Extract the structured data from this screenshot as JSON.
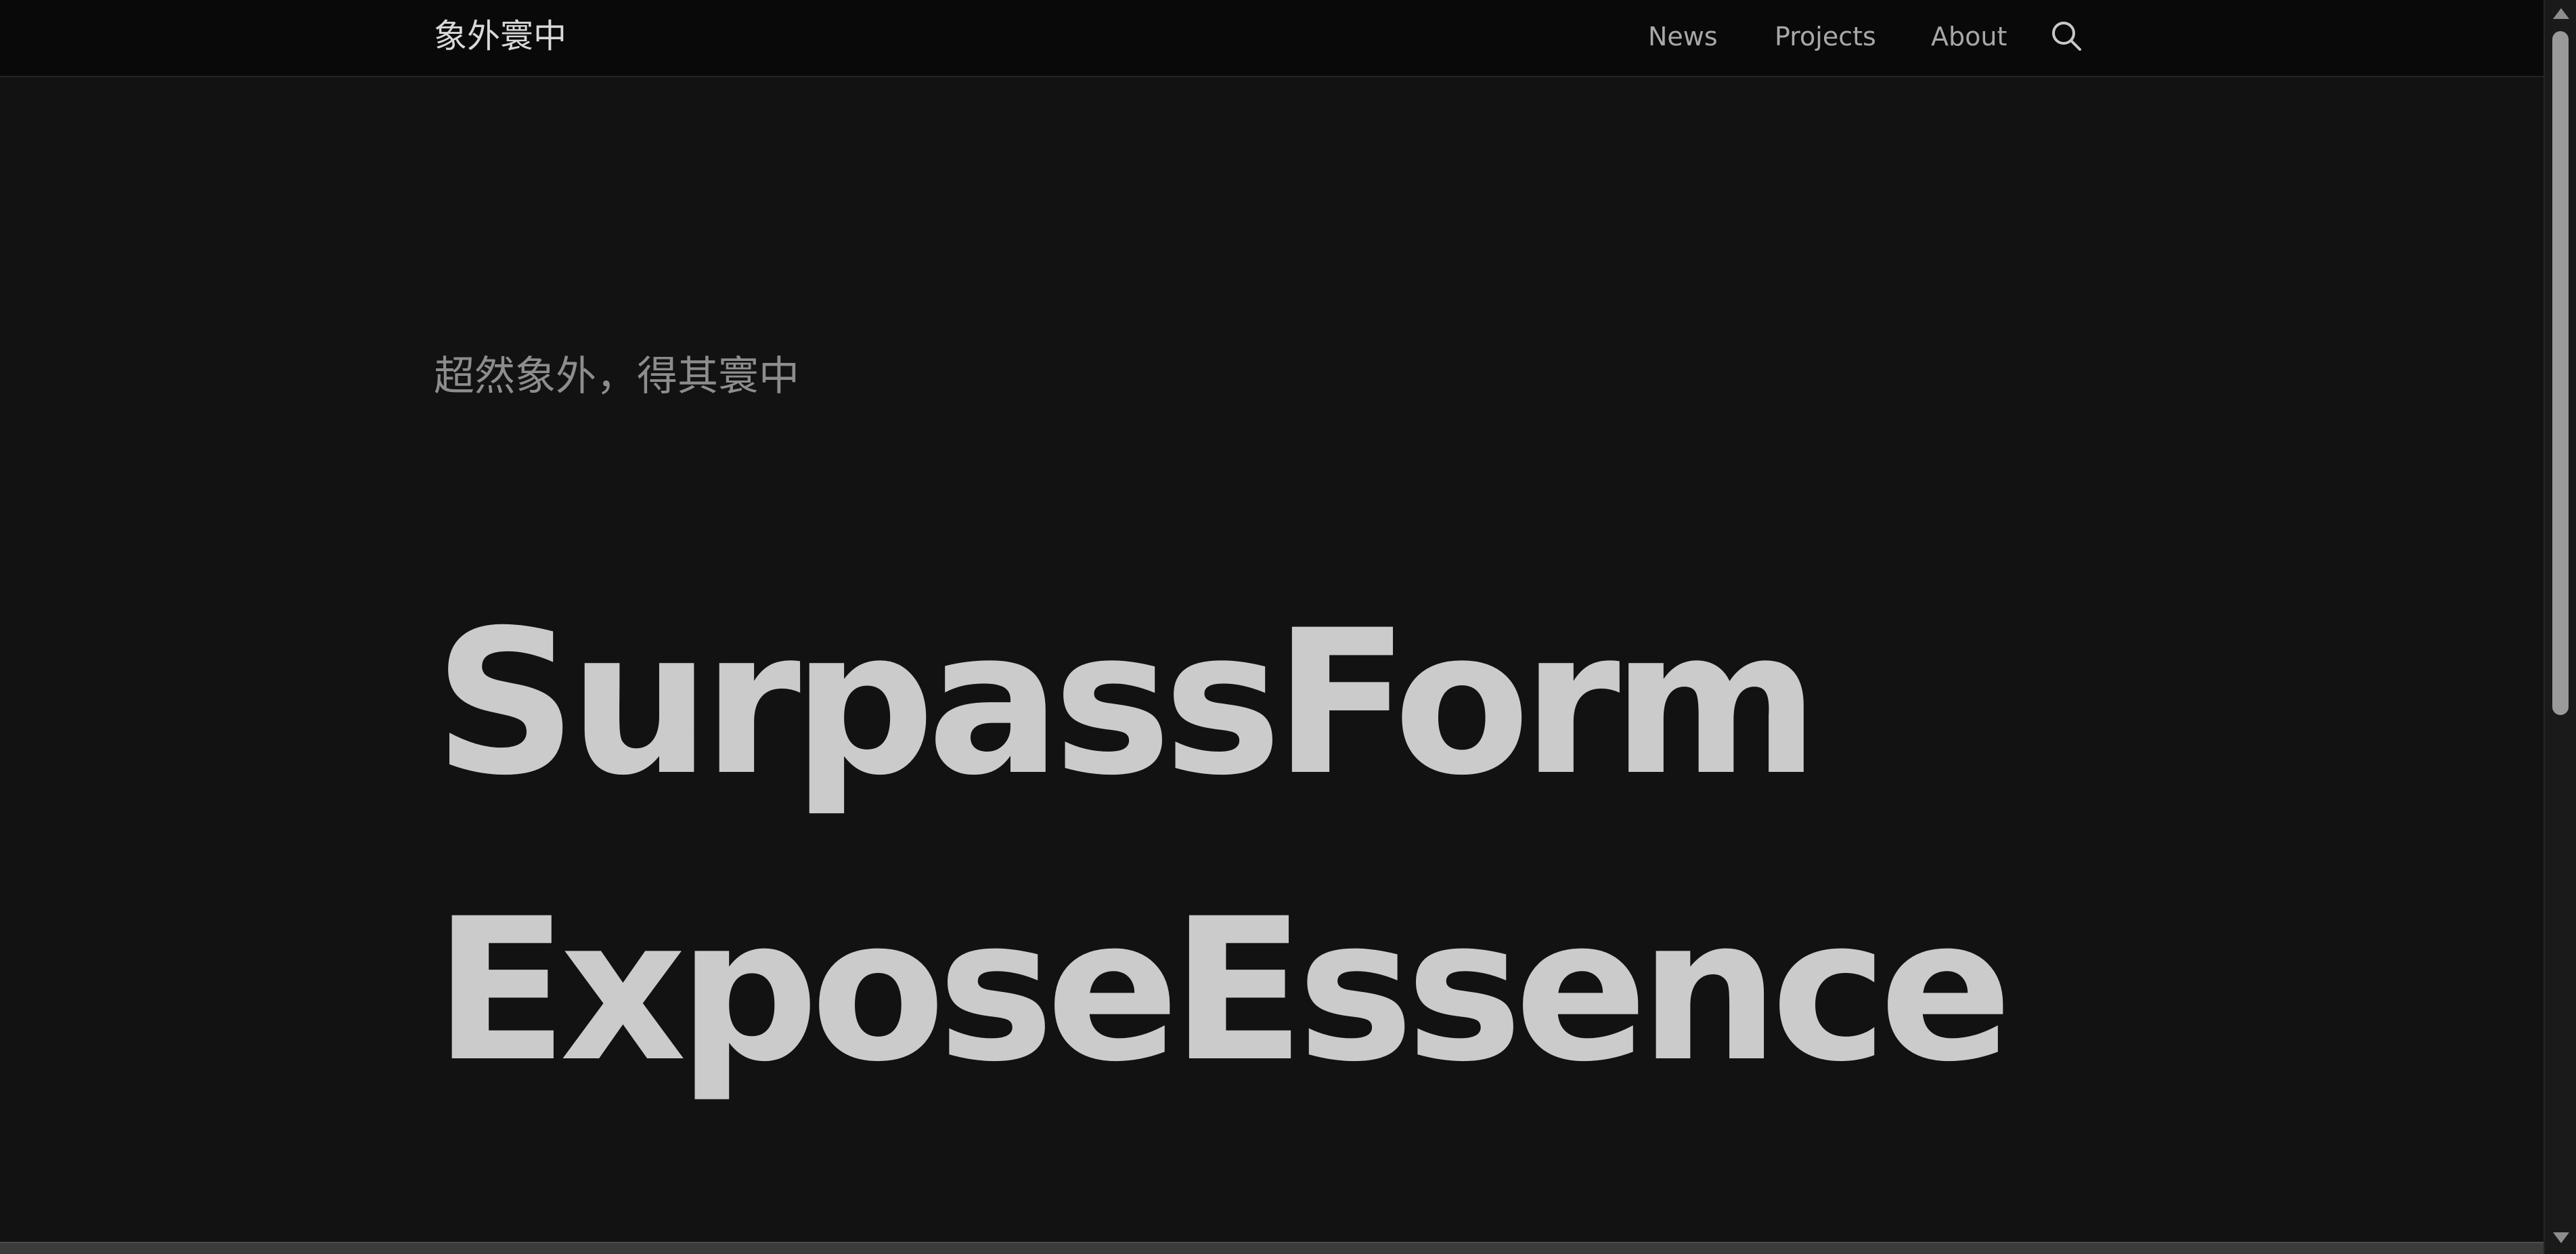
{
  "header": {
    "brand": "象外寰中",
    "nav": {
      "news": "News",
      "projects": "Projects",
      "about": "About"
    },
    "search_icon": "search-icon"
  },
  "hero": {
    "tagline": "超然象外，得其寰中",
    "line1": "SurpassForm",
    "line2": "ExposeEssence"
  },
  "scrollbar": {
    "up_icon": "triangle-up-icon",
    "down_icon": "triangle-down-icon"
  },
  "colors": {
    "background": "#121212",
    "navbar": "#090909",
    "text_primary": "#cbcbcb",
    "text_secondary": "#8d8d8d",
    "nav_text": "#a8a8a8"
  }
}
